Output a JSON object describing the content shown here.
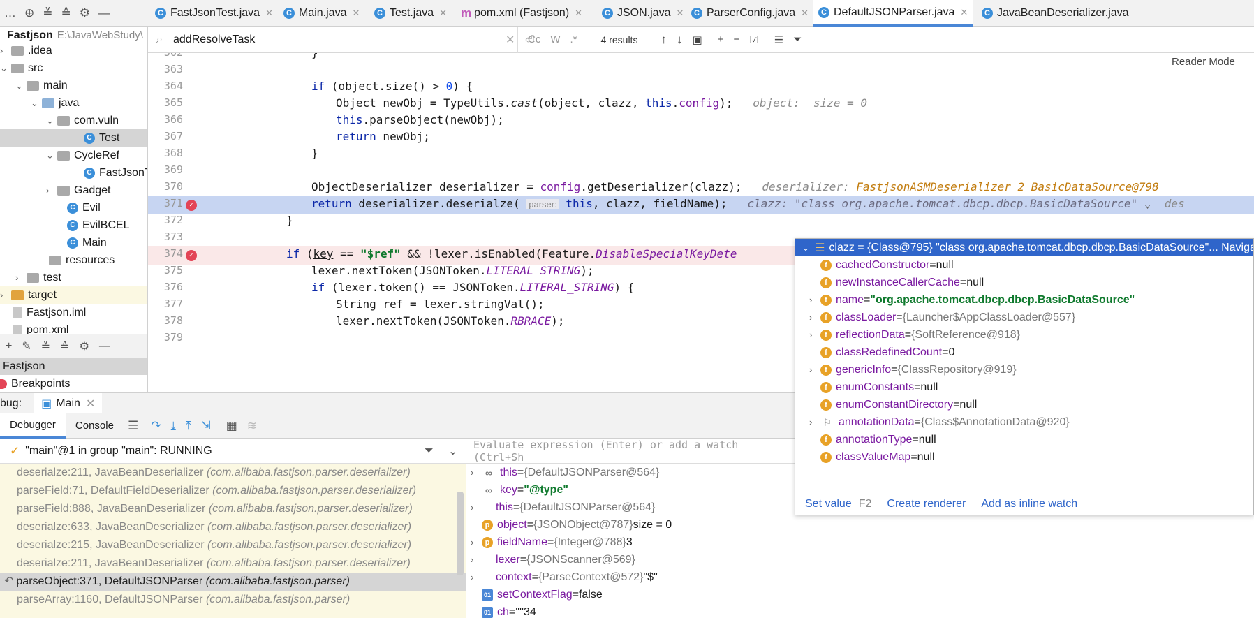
{
  "tabs": [
    {
      "label": "FastJsonTest.java",
      "icon": "class-test-icon"
    },
    {
      "label": "Main.java",
      "icon": "class-main-icon"
    },
    {
      "label": "Test.java",
      "icon": "class-icon"
    },
    {
      "label": "pom.xml (Fastjson)",
      "icon": "maven-icon"
    },
    {
      "label": "JSON.java",
      "icon": "class-icon"
    },
    {
      "label": "ParserConfig.java",
      "icon": "class-icon"
    },
    {
      "label": "DefaultJSONParser.java",
      "icon": "class-icon"
    },
    {
      "label": "JavaBeanDeserializer.java",
      "icon": "class-icon"
    }
  ],
  "project": {
    "root_name": "Fastjson",
    "root_path": "E:\\JavaWebStudy\\",
    "items": [
      {
        "label": ".idea"
      },
      {
        "label": "src"
      },
      {
        "label": "main"
      },
      {
        "label": "java"
      },
      {
        "label": "com.vuln"
      },
      {
        "label": "Test"
      },
      {
        "label": "CycleRef"
      },
      {
        "label": "FastJsonT"
      },
      {
        "label": "Gadget"
      },
      {
        "label": "Evil"
      },
      {
        "label": "EvilBCEL"
      },
      {
        "label": "Main"
      },
      {
        "label": "resources"
      },
      {
        "label": "test"
      },
      {
        "label": "target"
      },
      {
        "label": "Fastjson.iml"
      },
      {
        "label": "pom.xml"
      }
    ]
  },
  "bottom_left": {
    "project_label": "Fastjson",
    "breakpoints_label": "Breakpoints"
  },
  "find": {
    "query": "addResolveTask",
    "cc": "Cc",
    "w": "W",
    "regex": ".*",
    "results": "4 results"
  },
  "editor": {
    "reader_mode": "Reader Mode",
    "lines": [
      {
        "n": "362"
      },
      {
        "n": "363"
      },
      {
        "n": "364"
      },
      {
        "n": "365"
      },
      {
        "n": "366"
      },
      {
        "n": "367"
      },
      {
        "n": "368"
      },
      {
        "n": "369"
      },
      {
        "n": "370"
      },
      {
        "n": "371"
      },
      {
        "n": "372"
      },
      {
        "n": "373"
      },
      {
        "n": "374"
      },
      {
        "n": "375"
      },
      {
        "n": "376"
      },
      {
        "n": "377"
      },
      {
        "n": "378"
      },
      {
        "n": "379"
      }
    ],
    "hint_365": "object:  size = 0",
    "hint_370_label": "deserializer:",
    "hint_370_value": "FastjsonASMDeserializer_2_BasicDataSource@798",
    "hint_371": "clazz: \"class org.apache.tomcat.dbcp.dbcp.BasicDataSource\"",
    "hint_371_tail": "des",
    "param_hint": "parser:"
  },
  "debug": {
    "title": "bug:",
    "session": "Main",
    "tabs": [
      "Debugger",
      "Console"
    ],
    "thread": "\"main\"@1 in group \"main\": RUNNING",
    "eval_placeholder": "Evaluate expression (Enter) or add a watch (Ctrl+Sh",
    "frames": [
      {
        "method": "deserialze:211, JavaBeanDeserializer",
        "pkg": "(com.alibaba.fastjson.parser.deserializer)"
      },
      {
        "method": "parseField:71, DefaultFieldDeserializer",
        "pkg": "(com.alibaba.fastjson.parser.deserializer)"
      },
      {
        "method": "parseField:888, JavaBeanDeserializer",
        "pkg": "(com.alibaba.fastjson.parser.deserializer)"
      },
      {
        "method": "deserialze:633, JavaBeanDeserializer",
        "pkg": "(com.alibaba.fastjson.parser.deserializer)"
      },
      {
        "method": "deserialze:215, JavaBeanDeserializer",
        "pkg": "(com.alibaba.fastjson.parser.deserializer)"
      },
      {
        "method": "deserialze:211, JavaBeanDeserializer",
        "pkg": "(com.alibaba.fastjson.parser.deserializer)"
      },
      {
        "method": "parseObject:371, DefaultJSONParser",
        "pkg": "(com.alibaba.fastjson.parser)"
      },
      {
        "method": "parseArray:1160, DefaultJSONParser",
        "pkg": "(com.alibaba.fastjson.parser)"
      }
    ],
    "variables": [
      {
        "badge": "oo",
        "name": "this",
        "eq": " = ",
        "val": "{DefaultJSONParser@564}",
        "extra": ""
      },
      {
        "badge": "oo",
        "name": "key",
        "eq": " = ",
        "val": "\"@type\"",
        "extra": ""
      },
      {
        "badge": "",
        "name": "this",
        "eq": " = ",
        "val": "{DefaultJSONParser@564}",
        "extra": ""
      },
      {
        "badge": "p",
        "name": "object",
        "eq": " = ",
        "val": "{JSONObject@787}",
        "extra": " size = 0"
      },
      {
        "badge": "p",
        "name": "fieldName",
        "eq": " = ",
        "val": "{Integer@788}",
        "extra": " 3"
      },
      {
        "badge": "",
        "name": "lexer",
        "eq": " = ",
        "val": "{JSONScanner@569}",
        "extra": ""
      },
      {
        "badge": "",
        "name": "context",
        "eq": " = ",
        "val": "{ParseContext@572}",
        "extra": " \"$\""
      },
      {
        "badge": "01",
        "name": "setContextFlag",
        "eq": " = ",
        "val": "false",
        "extra": ""
      },
      {
        "badge": "01",
        "name": "ch",
        "eq": " = ",
        "val": "'\"'",
        "extra": " 34"
      }
    ]
  },
  "popup": {
    "header": "clazz = {Class@795} \"class org.apache.tomcat.dbcp.dbcp.BasicDataSource\"... Naviga",
    "fields": [
      {
        "name": "cachedConstructor",
        "val": "null"
      },
      {
        "name": "newInstanceCallerCache",
        "val": "null"
      },
      {
        "name": "name",
        "val": "\"org.apache.tomcat.dbcp.dbcp.BasicDataSource\""
      },
      {
        "name": "classLoader",
        "val": "{Launcher$AppClassLoader@557}"
      },
      {
        "name": "reflectionData",
        "val": "{SoftReference@918}"
      },
      {
        "name": "classRedefinedCount",
        "val": "0"
      },
      {
        "name": "genericInfo",
        "val": "{ClassRepository@919}"
      },
      {
        "name": "enumConstants",
        "val": "null"
      },
      {
        "name": "enumConstantDirectory",
        "val": "null"
      },
      {
        "name": "annotationData",
        "val": "{Class$AnnotationData@920}"
      },
      {
        "name": "annotationType",
        "val": "null"
      },
      {
        "name": "classValueMap",
        "val": "null"
      }
    ],
    "set_value": "Set value",
    "set_value_key": "F2",
    "create_renderer": "Create renderer",
    "add_inline_watch": "Add as inline watch"
  }
}
